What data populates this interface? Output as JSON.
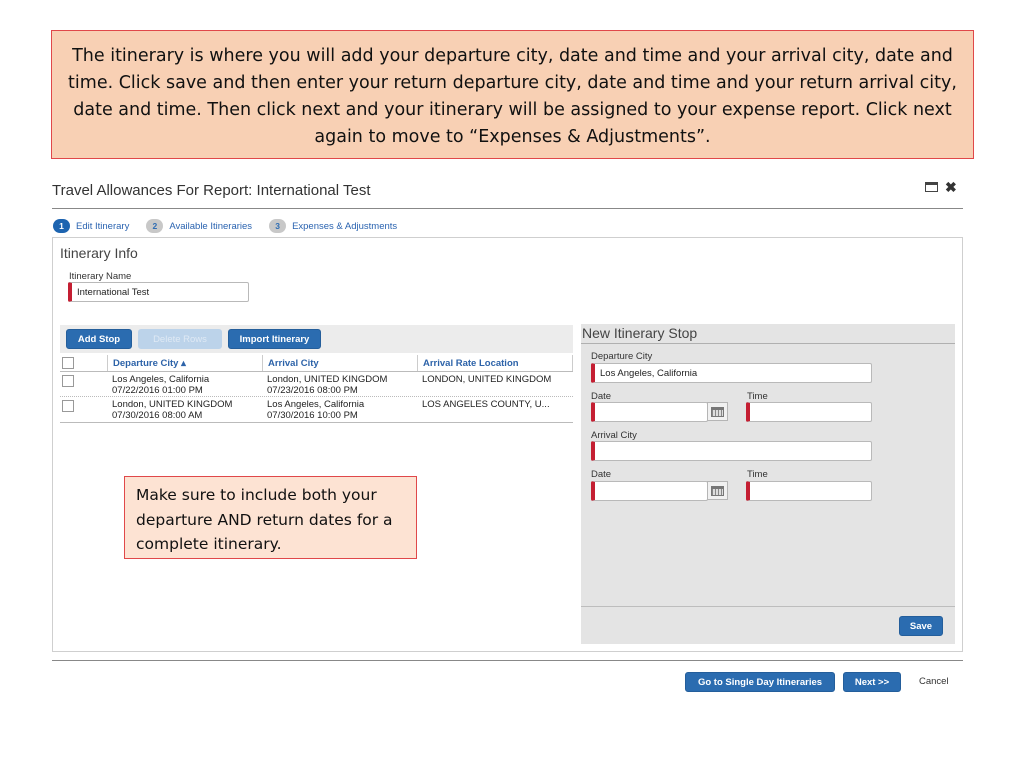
{
  "instructions": {
    "top_callout": "The itinerary  is where you will add  your departure city, date and time and your arrival city, date and time.  Click save and then enter your return departure city, date and time and your return arrival city, date and time.  Then click next and your itinerary will be assigned to your expense report.  Click next again to move to “Expenses & Adjustments”.",
    "note_callout": "Make sure to include both your departure AND return dates for a complete itinerary."
  },
  "dialog": {
    "title": "Travel Allowances For Report: International Test",
    "icons": {
      "maximize": "maximize-icon",
      "close": "✖"
    }
  },
  "steps": [
    {
      "number": "1",
      "label": "Edit Itinerary",
      "active": true
    },
    {
      "number": "2",
      "label": "Available Itineraries",
      "active": false
    },
    {
      "number": "3",
      "label": "Expenses & Adjustments",
      "active": false
    }
  ],
  "itinerary_info": {
    "section_title": "Itinerary Info",
    "name_label": "Itinerary Name",
    "name_value": "International Test"
  },
  "toolbar": {
    "add_stop": "Add Stop",
    "delete_rows": "Delete Rows",
    "import_itinerary": "Import Itinerary"
  },
  "table": {
    "columns": [
      "Departure City ▴",
      "Arrival City",
      "Arrival Rate Location"
    ],
    "rows": [
      {
        "departure_city": "Los Angeles, California",
        "departure_datetime": "07/22/2016 01:00 PM",
        "arrival_city": "London, UNITED KINGDOM",
        "arrival_datetime": "07/23/2016 08:00 PM",
        "rate_location": "LONDON, UNITED KINGDOM"
      },
      {
        "departure_city": "London, UNITED KINGDOM",
        "departure_datetime": "07/30/2016 08:00 AM",
        "arrival_city": "Los Angeles, California",
        "arrival_datetime": "07/30/2016 10:00 PM",
        "rate_location": "LOS ANGELES COUNTY, U..."
      }
    ]
  },
  "new_stop": {
    "title": "New Itinerary Stop",
    "departure_city_label": "Departure City",
    "departure_city_value": "Los Angeles, California",
    "date_label": "Date",
    "time_label": "Time",
    "arrival_city_label": "Arrival City",
    "arrival_city_value": "",
    "save": "Save"
  },
  "footer": {
    "single_day": "Go to Single Day Itineraries",
    "next": "Next >>",
    "cancel": "Cancel"
  }
}
